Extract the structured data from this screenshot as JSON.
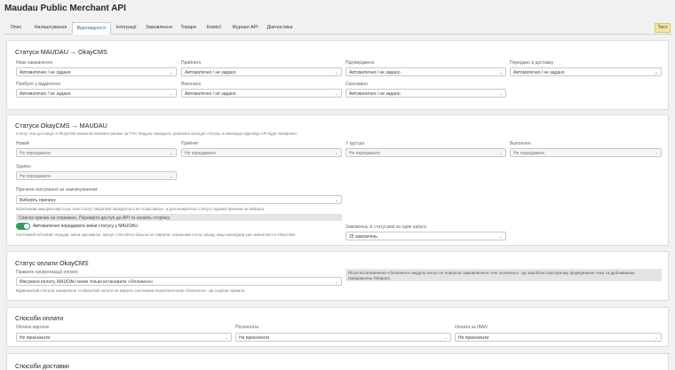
{
  "page_title": "Maudau Public Merchant API",
  "tabs": [
    {
      "label": "Опис"
    },
    {
      "label": "Налаштування"
    },
    {
      "label": "Відповідності"
    },
    {
      "label": "Інтеграції"
    },
    {
      "label": "Замовлення"
    },
    {
      "label": "Товари"
    },
    {
      "label": "Комісії"
    },
    {
      "label": "Журнал API"
    },
    {
      "label": "Діагностика"
    }
  ],
  "test_button": "Тест",
  "section1": {
    "title": "Статуси MAUDAU → OkayCMS",
    "fields": [
      {
        "label": "Нове замовлення",
        "value": "Автоматично / не задано"
      },
      {
        "label": "Прийнято",
        "value": "Автоматично / не задано"
      },
      {
        "label": "Підтверджено",
        "value": "Автоматично / не задано"
      },
      {
        "label": "Передано в доставку",
        "value": "Автоматично / не задано"
      },
      {
        "label": "Прибуло у відділення",
        "value": "Автоматично / не задано"
      },
      {
        "label": "Виконано",
        "value": "Автоматично / не задано"
      },
      {
        "label": "Скасовано",
        "value": "Автоматично / не задано"
      }
    ]
  },
  "section2": {
    "title": "Статуси OkayCMS → MAUDAU",
    "description": "Статус «На доставці» в OkayCMS можна встановити раніше за ТТН. Модуль передасть дозволені прохідні статуси, а невалідну відповідь API буде повернено.",
    "fields": [
      {
        "label": "Новий",
        "value": "Не передавати"
      },
      {
        "label": "Прийнят",
        "value": "Не передавати"
      },
      {
        "label": "У кур'єра",
        "value": "Не передавати"
      },
      {
        "label": "Выполнен",
        "value": "Не передавати"
      },
      {
        "label": "Удален",
        "value": "Не передавати"
      }
    ],
    "reason_label": "Причина скасування за замовчуванням",
    "reason_value": "Виберіть причину",
    "reason_hint": "Обов'язково використовується, коли статус OkayCMS передається як «Скасовано», а для конкретного статусу окремої причини не вибрано.",
    "warning": "Список причин не отримано. Перевірте доступ до API та оновіть сторінку.",
    "toggle_label": "Автоматично передавати зміни статусу у MAUDAU",
    "toggle_on": true,
    "toggle_hint": "Системний Scheduler передає зміни одноманно. Імпорт з MAUDAU більше не повертає локальний статус назад, якщо менеджер уже змінив його в OkayCMS.",
    "batch_label": "Замовлень зі статусами за один запуск",
    "batch_value": "25 замовлень"
  },
  "section3": {
    "title": "Статус оплати OkayCMS",
    "label": "Правило синхронізації оплати",
    "value": "Фіксувати оплату, MAUDAU може тільки встановити «Оплачено»",
    "hint": "Відмінюючий статусів замовлення та OkayCMS оплати не керують системним переключенням «Оплачено». Це скоріше правило.",
    "notice": "Після встановлення «Оплачено» модуль нічого не повертає замовлення в «Не оплачено». Це запобігає повторному формуванню чека та дублюванню повідомлень Telegram."
  },
  "section4": {
    "title": "Способи оплати",
    "fields": [
      {
        "label": "Оплата карткою",
        "value": "Не призначати"
      },
      {
        "label": "Післяплата",
        "value": "Не призначати"
      },
      {
        "label": "Оплата за IBAN",
        "value": "Не призначати"
      }
    ]
  },
  "section5": {
    "title": "Способи доставки"
  }
}
